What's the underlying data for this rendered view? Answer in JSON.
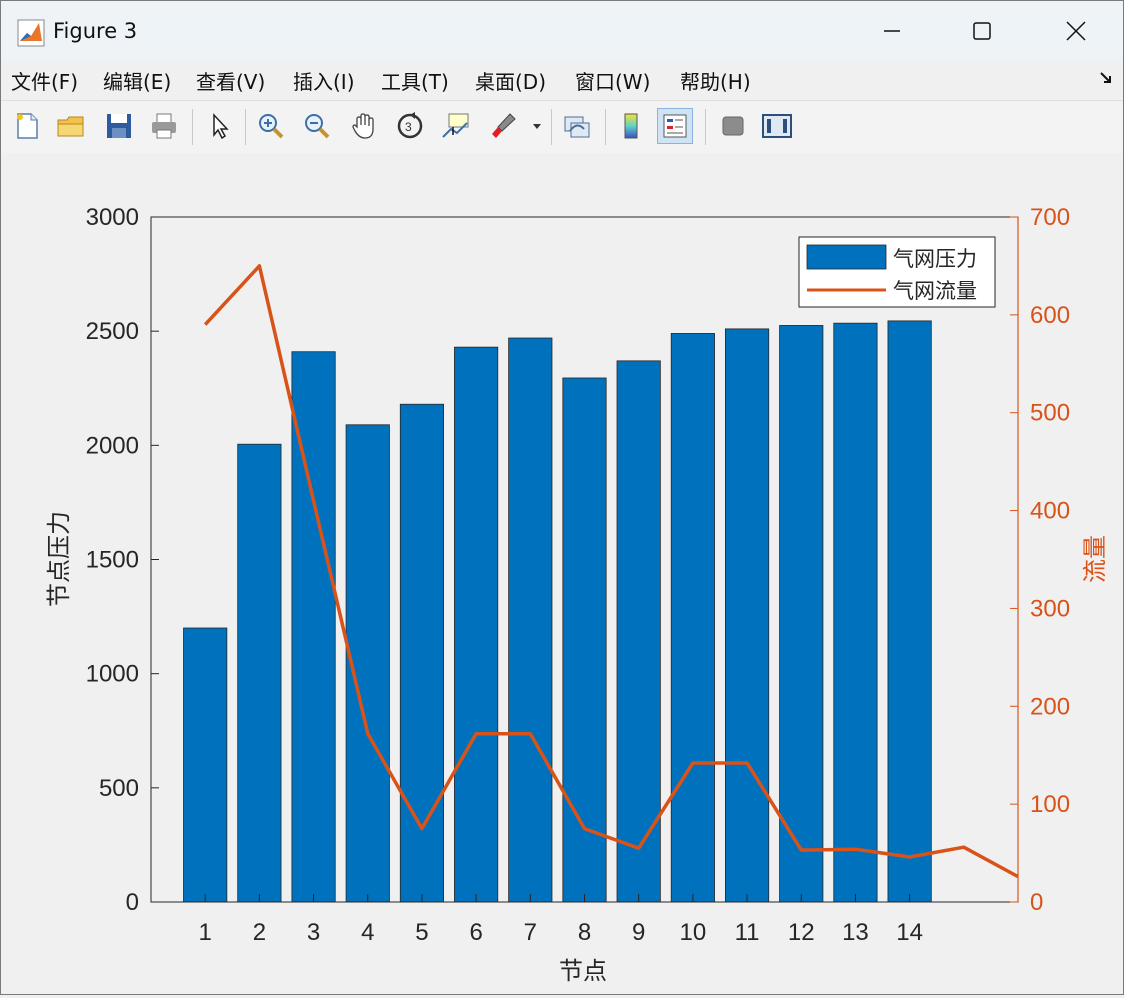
{
  "window": {
    "title": "Figure 3",
    "icons": [
      "matlab-icon",
      "minimize-icon",
      "maximize-icon",
      "close-icon"
    ]
  },
  "menu": [
    "文件(F)",
    "编辑(E)",
    "查看(V)",
    "插入(I)",
    "工具(T)",
    "桌面(D)",
    "窗口(W)",
    "帮助(H)"
  ],
  "toolbar": {
    "icons": [
      "new-file-icon",
      "open-folder-icon",
      "save-icon",
      "print-icon",
      "pointer-icon",
      "zoom-in-icon",
      "zoom-out-icon",
      "pan-hand-icon",
      "rotate-3d-icon",
      "data-cursor-icon",
      "brush-icon",
      "link-plot-icon",
      "colorbar-icon",
      "legend-icon",
      "hide-plot-tools-icon",
      "show-plot-tools-icon"
    ]
  },
  "colors": {
    "bar": "#0072BD",
    "line": "#D95319",
    "axis": "#262626"
  },
  "chart_data": {
    "type": "bar",
    "categories": [
      "1",
      "2",
      "3",
      "4",
      "5",
      "6",
      "7",
      "8",
      "9",
      "10",
      "11",
      "12",
      "13",
      "14"
    ],
    "series": [
      {
        "name": "气网压力",
        "type": "bar",
        "axis": "left",
        "values": [
          1200,
          2005,
          2410,
          2090,
          2180,
          2430,
          2470,
          2295,
          2370,
          2490,
          2510,
          2525,
          2535,
          2545
        ]
      }
    ],
    "line_series": {
      "name": "气网流量",
      "type": "line",
      "axis": "right",
      "x": [
        1,
        2,
        3,
        4,
        5,
        6,
        7,
        8,
        9,
        10,
        11,
        12,
        13,
        14,
        15,
        16
      ],
      "values": [
        590,
        650,
        410,
        172,
        75,
        172,
        172,
        75,
        55,
        142,
        142,
        53,
        54,
        46,
        56,
        26
      ]
    },
    "xlabel": "节点",
    "ylabel": "节点压力",
    "y2label": "流量",
    "ylim": [
      0,
      3000
    ],
    "y2lim": [
      0,
      700
    ],
    "xlim": [
      0,
      16
    ],
    "yticks": [
      0,
      500,
      1000,
      1500,
      2000,
      2500,
      3000
    ],
    "y2ticks": [
      0,
      100,
      200,
      300,
      400,
      500,
      600,
      700
    ],
    "legend": {
      "placement": "top-right",
      "entries": [
        "气网压力",
        "气网流量"
      ]
    },
    "grid": false
  }
}
